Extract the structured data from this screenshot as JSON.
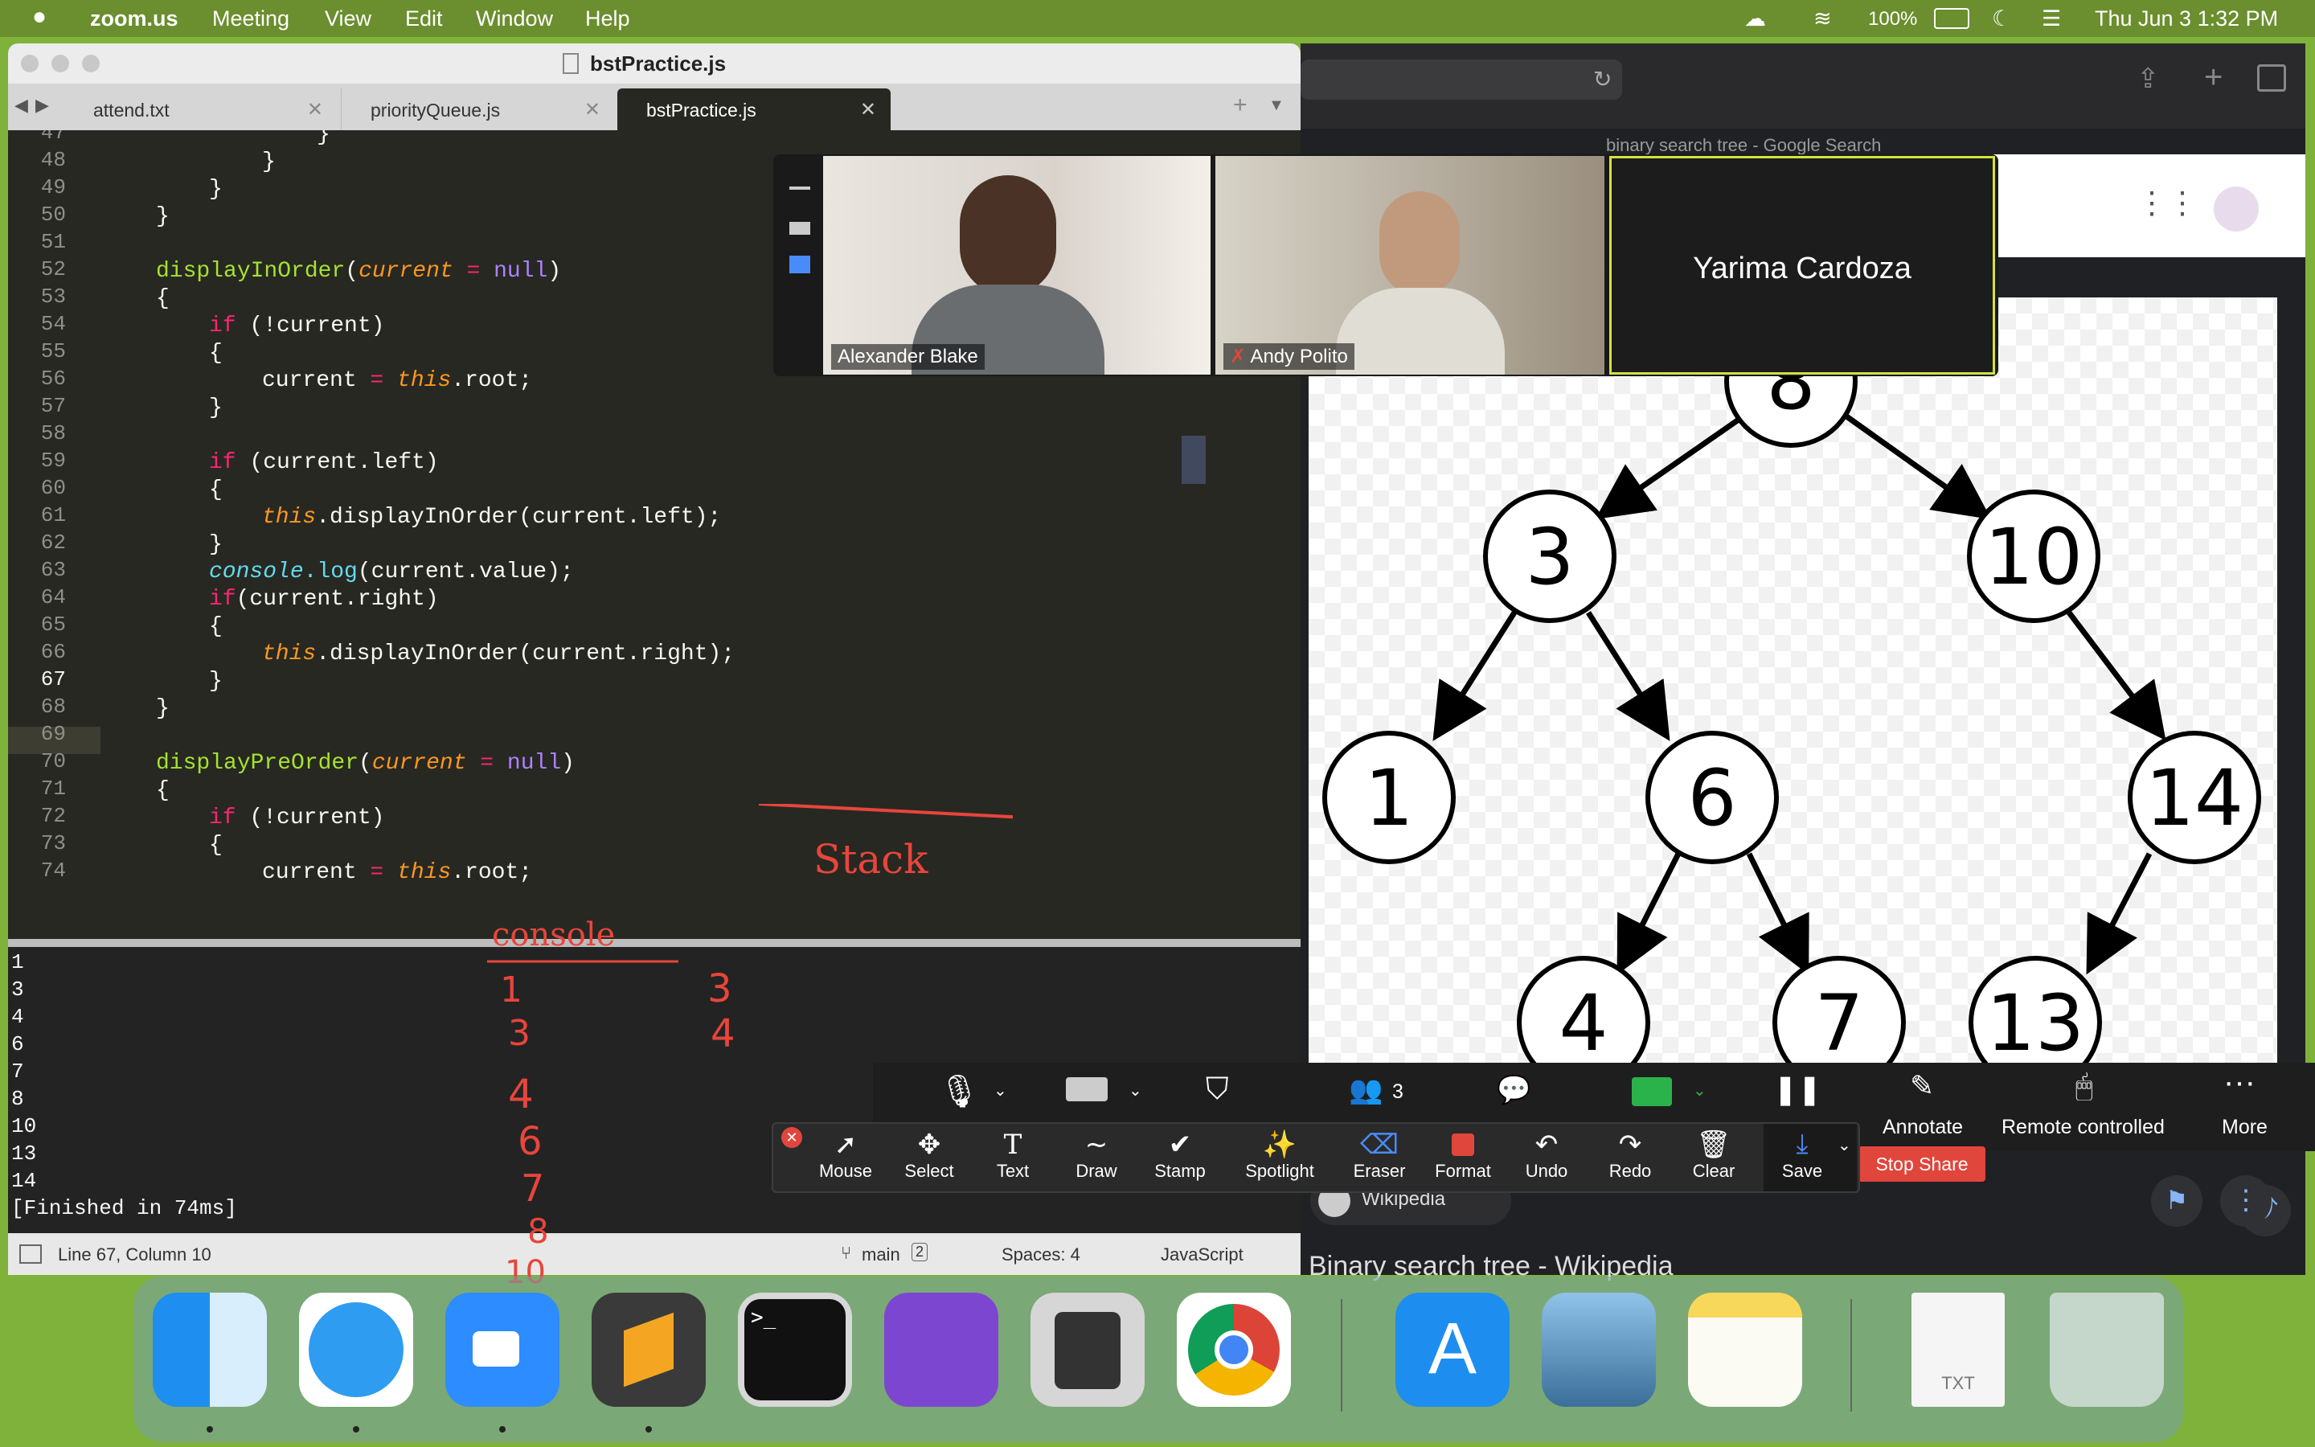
{
  "menubar": {
    "app_name": "zoom.us",
    "menus": [
      "Meeting",
      "View",
      "Edit",
      "Window",
      "Help"
    ],
    "battery": "100%",
    "datetime": "Thu Jun 3  1:32 PM"
  },
  "editor": {
    "file_title": "bstPractice.js",
    "tabs": [
      {
        "label": "attend.txt"
      },
      {
        "label": "priorityQueue.js"
      },
      {
        "label": "bstPractice.js",
        "active": true
      }
    ],
    "line_numbers": [
      "47",
      "48",
      "49",
      "50",
      "51",
      "52",
      "53",
      "54",
      "55",
      "56",
      "57",
      "58",
      "59",
      "60",
      "61",
      "62",
      "63",
      "64",
      "65",
      "66",
      "67",
      "68",
      "69",
      "70",
      "71",
      "72",
      "73",
      "74"
    ],
    "current_line": "67",
    "code": {
      "l47": "}",
      "l48": "}",
      "l49": "}",
      "l50": "}",
      "l52_name": "displayInOrder",
      "l52_param": "current",
      "l52_eq": " = ",
      "l52_null": "null",
      "l53": "{",
      "l54_if": "if",
      "l54_rest": " (!current)",
      "l55": "{",
      "l56_a": "current",
      "l56_eq": " = ",
      "l56_this": "this",
      "l56_rest": ".root;",
      "l57": "}",
      "l59_if": "if",
      "l59_rest": " (current.left)",
      "l60": "{",
      "l61_this": "this",
      "l61_rest": ".displayInOrder(current.left);",
      "l62": "}",
      "l63_console": "console",
      "l63_log": ".log",
      "l63_rest": "(current.value);",
      "l64_if": "if",
      "l64_rest": "(current.right)",
      "l65": "{",
      "l66_this": "this",
      "l66_rest": ".displayInOrder(current.right);",
      "l67": "}",
      "l68": "}",
      "l70_name": "displayPreOrder",
      "l70_param": "current",
      "l70_eq": " = ",
      "l70_null": "null",
      "l71": "{",
      "l72_if": "if",
      "l72_rest": " (!current)",
      "l73": "{",
      "l74_a": "current",
      "l74_eq": " = ",
      "l74_this": "this",
      "l74_rest": ".root;"
    },
    "console_output": [
      "1",
      "3",
      "4",
      "6",
      "7",
      "8",
      "10",
      "13",
      "14",
      "[Finished in 74ms]"
    ],
    "status": {
      "position": "Line 67, Column 10",
      "branch": "main",
      "branch_count": "2",
      "spaces": "Spaces: 4",
      "syntax": "JavaScript"
    }
  },
  "annotations": {
    "stack_label": "Stack",
    "console_label": "console",
    "stack_col": [
      "3",
      "4"
    ],
    "console_col": [
      "1",
      "3",
      "4",
      "6",
      "7",
      "8",
      "10"
    ]
  },
  "browser": {
    "tab_title": "binary search tree - Google Search",
    "result_source": "Wikipedia",
    "result_title": "Binary search tree - Wikipedia",
    "tree_nodes": [
      "8",
      "3",
      "10",
      "1",
      "6",
      "14",
      "4",
      "7",
      "13"
    ]
  },
  "participants": [
    {
      "name": "Alexander Blake"
    },
    {
      "name": "Andy Polito",
      "muted": true
    },
    {
      "name": "Yarima Cardoza"
    }
  ],
  "zoom_toolbar": {
    "participants_count": "3",
    "annotate": "Annotate",
    "remote": "Remote controlled",
    "more": "More",
    "stop_share": "Stop Share"
  },
  "annotate_tools": [
    "Mouse",
    "Select",
    "Text",
    "Draw",
    "Stamp",
    "Spotlight",
    "Eraser",
    "Format",
    "Undo",
    "Redo",
    "Clear",
    "Save"
  ],
  "dock": {
    "apps": [
      "finder-icon",
      "safari-icon",
      "zoom-icon",
      "sublime-text-icon",
      "terminal-icon",
      "github-desktop-icon",
      "calculator-icon",
      "chrome-icon",
      "app-store-icon",
      "preview-icon",
      "notes-icon",
      "txt-file-icon",
      "trash-icon"
    ],
    "txt_label": "TXT"
  },
  "colors": {
    "accent_green": "#7fb23a",
    "annotation_red": "#e8453c",
    "stop_share_red": "#e0463c"
  }
}
